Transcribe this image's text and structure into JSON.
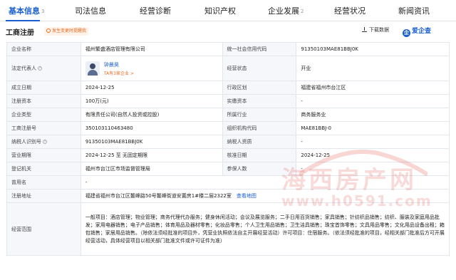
{
  "tabs": [
    {
      "label": "基本信息",
      "count": "3"
    },
    {
      "label": "司法信息",
      "count": ""
    },
    {
      "label": "经营诊断",
      "count": ""
    },
    {
      "label": "知识产权",
      "count": ""
    },
    {
      "label": "企业发展",
      "count": "2"
    },
    {
      "label": "经营状况",
      "count": ""
    },
    {
      "label": "新闻资讯",
      "count": ""
    }
  ],
  "section": {
    "title": "工商注册",
    "warning": "发生变更时提醒我",
    "download": "下载数据",
    "brand": "爱企查"
  },
  "rows": {
    "r1": {
      "l1": "企业名称",
      "v1": "福州繁盛酒店管理有限公司",
      "l2": "统一社会信用代码",
      "v2": "91350103MAE81BBJ0K"
    },
    "r2": {
      "l1": "法定代表人",
      "rep_name": "钟晨昊",
      "rep_sub": "TA有3家企业 >",
      "l2": "经营状态",
      "v2": "开业"
    },
    "r3": {
      "l1": "成立日期",
      "v1": "2024-12-25",
      "l2": "行政区划",
      "v2": "福建省福州市台江区"
    },
    "r4": {
      "l1": "注册资本",
      "v1": "100万(元)",
      "l2": "实缴资本",
      "v2": "-"
    },
    "r5": {
      "l1": "企业类型",
      "v1": "有限责任公司(自然人投资或控股)",
      "l2": "所属行业",
      "v2": "商务服务业"
    },
    "r6": {
      "l1": "工商注册号",
      "v1": "350103110463480",
      "l2": "组织机构代码",
      "v2": "MAE81BBJ-0"
    },
    "r7": {
      "l1": "纳税人识别号",
      "v1": "91350103MAE81BBJ0K",
      "l2": "纳税人资质",
      "v2": "-"
    },
    "r8": {
      "l1": "营业期限",
      "v1": "2024-12-25 至 无固定期限",
      "l2": "核准日期",
      "v2": "2024-12-25"
    },
    "r9": {
      "l1": "登记机关",
      "v1": "福州市台江区市场监督管理局",
      "l2": "参保人数",
      "v2": "-"
    },
    "r10": {
      "l1": "曾用名",
      "v1": "-"
    },
    "r11": {
      "l1": "注册地址",
      "v1": "福建省福州市台江区鳌峰路50号鳌峰街道安置房1#楼二层2322室",
      "link": "查看地图"
    },
    "r12": {
      "l1": "经营范围",
      "v1": "一般项目：酒店管理；物业管理；商务代理代办服务；健身休闲活动；会议及展览服务；二手日用百货销售；家具销售；针纺织品销售；纺织、服装及家庭用品批发；家用电器销售；电子产品销售；体育用品及器材零售；化妆品零售；个人卫生用品销售；卫生洁具销售；珠宝首饰零售；文具用品零售；文化用品设备出租；箱包销售；家居用品销售。（除依法须经批准的项目外，凭营业执照依法自主开展经营活动）许可项目：住宿服务。（依法须经批准的项目，经相关部门批准后方可开展经营活动，具体经营项目以相关部门批准文件或许可证件为准）"
    }
  },
  "watermark": {
    "line1": "海西房产网",
    "line2": "www.h0591.com"
  }
}
